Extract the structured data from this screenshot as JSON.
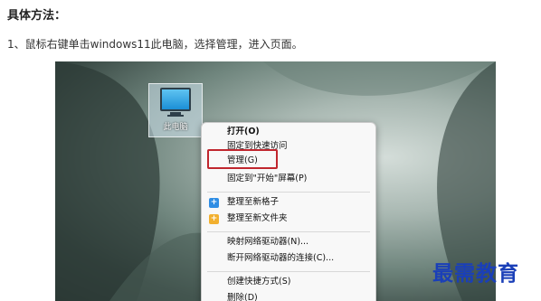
{
  "article": {
    "heading": "具体方法：",
    "step1": "1、鼠标右键单击windows11此电脑，选择管理，进入页面。"
  },
  "desktop": {
    "icon_label": "此电脑"
  },
  "context_menu": {
    "items": [
      "打开(O)",
      "固定到快速访问",
      "管理(G)",
      "固定到\"开始\"屏幕(P)",
      "整理至新格子",
      "整理至新文件夹",
      "映射网络驱动器(N)...",
      "断开网络驱动器的连接(C)...",
      "创建快捷方式(S)",
      "删除(D)"
    ],
    "highlight_color": "#c0262e"
  },
  "watermark": "最需教育"
}
